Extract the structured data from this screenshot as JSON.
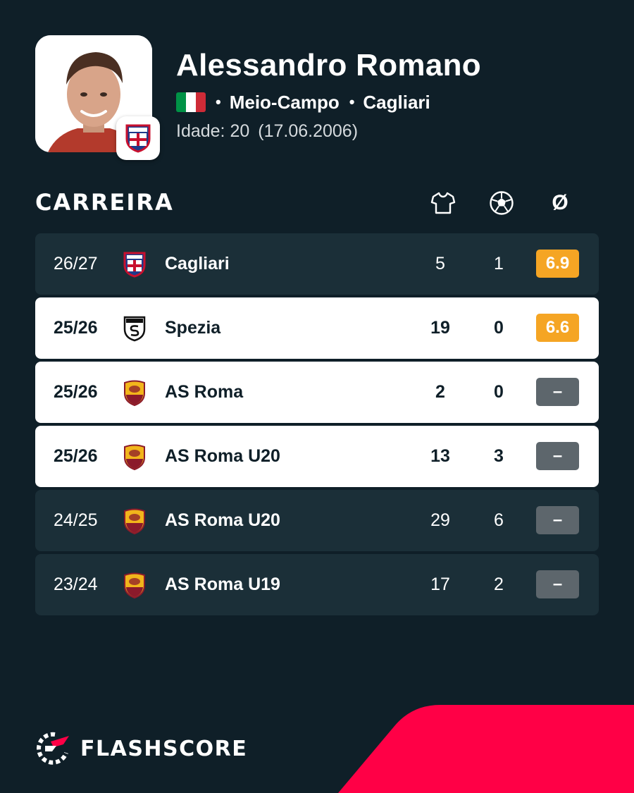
{
  "player": {
    "name": "Alessandro Romano",
    "position": "Meio-Campo",
    "club": "Cagliari",
    "age_label": "Idade: 20",
    "dob": "(17.06.2006)",
    "separator": "•",
    "flag_colors": [
      "#009246",
      "#ffffff",
      "#ce2b37"
    ]
  },
  "career": {
    "title": "CARREIRA",
    "columns": [
      {
        "icon": "jersey-icon"
      },
      {
        "icon": "football-icon"
      },
      {
        "icon": "average-icon",
        "label": "Ø"
      }
    ],
    "rows": [
      {
        "season": "26/27",
        "team": "Cagliari",
        "logo": "cagliari-logo",
        "apps": "5",
        "goals": "1",
        "rating": "6.9",
        "highlight": false
      },
      {
        "season": "25/26",
        "team": "Spezia",
        "logo": "spezia-logo",
        "apps": "19",
        "goals": "0",
        "rating": "6.6",
        "highlight": true
      },
      {
        "season": "25/26",
        "team": "AS Roma",
        "logo": "roma-logo",
        "apps": "2",
        "goals": "0",
        "rating": "–",
        "highlight": true
      },
      {
        "season": "25/26",
        "team": "AS Roma U20",
        "logo": "roma-logo",
        "apps": "13",
        "goals": "3",
        "rating": "–",
        "highlight": true
      },
      {
        "season": "24/25",
        "team": "AS Roma U20",
        "logo": "roma-logo",
        "apps": "29",
        "goals": "6",
        "rating": "–",
        "highlight": false
      },
      {
        "season": "23/24",
        "team": "AS Roma U19",
        "logo": "roma-logo",
        "apps": "17",
        "goals": "2",
        "rating": "–",
        "highlight": false
      }
    ]
  },
  "brand": {
    "name": "FLASHSCORE",
    "accent": "#ff0046"
  },
  "colors": {
    "background": "#0f1f28",
    "row_dark": "#1b2f38",
    "row_light": "#ffffff",
    "rating_orange": "#f5a524",
    "rating_grey": "#5d666c"
  }
}
